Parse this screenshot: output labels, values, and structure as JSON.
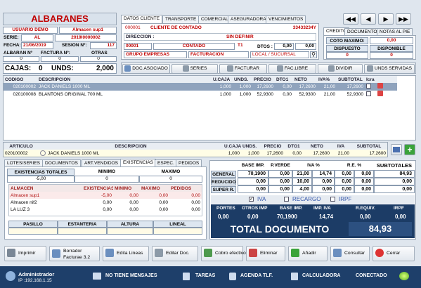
{
  "header": {
    "title": "ALBARANES",
    "user": "USUARIO DEMO",
    "warehouse": "Almacen sup1",
    "serie_label": "SERIE:",
    "serie": "AL",
    "doc_number": "2019I0000002",
    "fecha_label": "FECHA:",
    "fecha": "21/06/2019",
    "sesion_label": "SESION Nº:",
    "sesion": "117",
    "albaran_label": "ALBARAN Nº",
    "factura_label": "FACTURA Nº:",
    "otras_label": "OTRAS",
    "albaran_val": "0",
    "factura_val": "0",
    "otras_val": "0",
    "cajas_label": "CAJAS:",
    "cajas": "0",
    "unds_label": "UNDS:",
    "unds": "2,000"
  },
  "client_tabs": [
    "DATOS CLIENTE",
    "TRANSPORTE",
    "COMERCIAL",
    "ASEGURADORA",
    "VENCIMIENTOS"
  ],
  "client": {
    "code": "000001",
    "name": "CLIENTE DE CONTADO",
    "nif": "33433234Y",
    "direccion_label": "DIRECCION :",
    "direccion": "SIN DEFINIR",
    "cp": "00001",
    "city": "CONTADO",
    "tarifa": "T1",
    "dtos_label": "DTOS :",
    "dto1": "0,00",
    "dto2": "0,00",
    "grupo": "GRUPO EMPRESAS",
    "facturacion": "FACTURACION",
    "local": "LOCAL / SUCURSAL"
  },
  "credit": {
    "tabs": [
      "CREDITO",
      "DOCUMENTO",
      "NOTAS AL PIE"
    ],
    "coto_label": "COTO MAXIMO:",
    "coto": "0,00",
    "disp_label": "DISPUESTO",
    "disp": "0",
    "disponible_label": "DISPONIBLE",
    "disponible": "0"
  },
  "nav_buttons": [
    "first",
    "prev",
    "next",
    "last"
  ],
  "toolbar": [
    "DOC.ASOCIADO",
    "SERIES",
    "FACTURAR",
    "FAC.LIBRE",
    "DIVIDIR",
    "UNDS SERVIDAS"
  ],
  "lines": {
    "columns": [
      "CODIGO",
      "DESCRIPCION",
      "U.CAJA",
      "UNDS.",
      "PRECIO",
      "DTO1",
      "NETO",
      "IVA%",
      "SUBTOTAL",
      "Icra"
    ],
    "rows": [
      {
        "codigo": "020100002",
        "desc": "JACK DANIELS 1000 ML",
        "ucaja": "1,000",
        "unds": "1,000",
        "precio": "17,2600",
        "dto": "0,00",
        "neto": "17,2600",
        "iva": "21,00",
        "subtotal": "17,2600"
      },
      {
        "codigo": "020100008",
        "desc": "BLANTONS ORIGINAL 700 ML",
        "ucaja": "1,000",
        "unds": "1,000",
        "precio": "52,9300",
        "dto": "0,00",
        "neto": "52,9300",
        "iva": "21,00",
        "subtotal": "52,9300"
      }
    ]
  },
  "edit": {
    "columns": [
      "ARTICULO",
      "DESCRIPCION",
      "U.CAJA",
      "UNDS.",
      "PRECIO",
      "DTO1",
      "NETO",
      "IVA",
      "SUBTOTAL"
    ],
    "articulo": "020100002",
    "desc": "JACK DANIELS 1000 ML",
    "ucaja": "1,000",
    "unds": "1,000",
    "precio": "17,2600",
    "dto1": "0,00",
    "neto": "17,2600",
    "iva": "21,00",
    "subtotal": "17,2600"
  },
  "lower_tabs": [
    "LOTES/SERIES",
    "DOCUMENTOS",
    "ART.VENDIDOS",
    "EXISTENCIAS",
    "ESPEC.",
    "PEDIDOS"
  ],
  "existencias": {
    "h1": "EXISTENCIAS TOTALES",
    "h2": "MINIMO",
    "h3": "MAXIMO",
    "v1": "-5,00",
    "v2": "0",
    "v3": "0",
    "columns": [
      "ALMACEN",
      "EXISTENCIAS",
      "MINIMO",
      "MAXIMO",
      "PEDIDOS"
    ],
    "rows": [
      {
        "a": "Almacen sup1",
        "e": "-5,00",
        "mi": "0,00",
        "ma": "0,00",
        "p": "0,00"
      },
      {
        "a": "Almacen nif2",
        "e": "0,00",
        "mi": "0,00",
        "ma": "0,00",
        "p": "0,00"
      },
      {
        "a": "LA LUZ 3",
        "e": "0,00",
        "mi": "0,00",
        "ma": "0,00",
        "p": "0,00"
      }
    ],
    "footer": [
      "PASILLO",
      "ESTANTERIA",
      "ALTURA",
      "LINEAL"
    ]
  },
  "totals": {
    "headers": [
      "BASE IMP.",
      "P.VERDE",
      "IVA %",
      "R.E. %",
      "SUBTOTALES"
    ],
    "rows": [
      {
        "label": "GENERAL",
        "base": "70,1900",
        "pv": "0,00",
        "iva": "21,00",
        "ivaimp": "14,74",
        "re": "0,00",
        "reimp": "0,00",
        "sub": "84,93"
      },
      {
        "label": "REDUCIDO",
        "base": "0,00",
        "pv": "0,00",
        "iva": "10,00",
        "ivaimp": "0,00",
        "re": "0,00",
        "reimp": "0,00",
        "sub": "0,00"
      },
      {
        "label": "SUPER R.",
        "base": "0,00",
        "pv": "0,00",
        "iva": "4,00",
        "ivaimp": "0,00",
        "re": "0,00",
        "reimp": "0,00",
        "sub": "0,00"
      }
    ],
    "checks": [
      "IVA",
      "RECARGO",
      "IRPF"
    ],
    "sum_headers": [
      "PORTES",
      "OTROS IMP",
      "BASE IMP.",
      "IMP. IVA",
      "R.EQUIV.",
      "IRPF"
    ],
    "sum_values": [
      "0,00",
      "0,00",
      "70,1900",
      "14,74",
      "0,00",
      "0,00"
    ],
    "total_label": "TOTAL DOCUMENTO",
    "total": "84,93"
  },
  "bottom": [
    "Imprimir",
    "Borrador Facturae 3.2",
    "Edita Lineas",
    "Editar Doc.",
    "Cobro efectivo",
    "Eliminar",
    "Añadir",
    "Consultar",
    "Cerrar"
  ],
  "status": {
    "user": "Administrador",
    "ip": "IP :192.168.1.15",
    "msgs": "NO TIENE MENSAJES",
    "tareas": "TAREAS",
    "agenda": "AGENDA TLF.",
    "calc": "CALCULADORA",
    "conn": "CONECTADO"
  },
  "colors": {
    "accent": "#c00000",
    "selrow": "#8fa3bd",
    "statusbar": "#1e3f6a",
    "total": "#1c3c66"
  }
}
